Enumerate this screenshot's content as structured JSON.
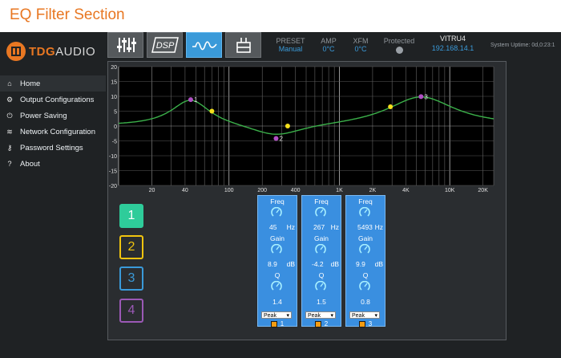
{
  "page_title": "EQ Filter Section",
  "brand": {
    "logo_prefix": "TDG",
    "logo_suffix": "AUDIO"
  },
  "nav": [
    {
      "icon": "home-icon",
      "glyph": "⌂",
      "label": "Home"
    },
    {
      "icon": "gear-icon",
      "glyph": "⚙",
      "label": "Output Configurations"
    },
    {
      "icon": "power-icon",
      "glyph": "⏻",
      "label": "Power Saving"
    },
    {
      "icon": "wifi-icon",
      "glyph": "≋",
      "label": "Network Configuration"
    },
    {
      "icon": "key-icon",
      "glyph": "⚷",
      "label": "Password Settings"
    },
    {
      "icon": "question-icon",
      "glyph": "?",
      "label": "About"
    }
  ],
  "toolbar": {
    "dsp_label": "DSP"
  },
  "status": {
    "preset_label": "PRESET",
    "preset_value": "Manual",
    "amp_label": "AMP",
    "amp_value": "0°C",
    "xfm_label": "XFM",
    "xfm_value": "0°C",
    "protected_label": "Protected",
    "device_name": "VITRU4",
    "device_ip": "192.168.14.1",
    "uptime": "System Uptime: 0d,0:23:1"
  },
  "graph": {
    "y_ticks": [
      "20",
      "15",
      "10",
      "5",
      "0",
      "-5",
      "-10",
      "-15",
      "-20"
    ],
    "x_ticks": [
      "20",
      "40",
      "100",
      "200",
      "400",
      "1K",
      "2K",
      "4K",
      "10K",
      "20K"
    ],
    "points": [
      {
        "label": "1",
        "freq": 45,
        "gain": 8.9
      },
      {
        "label": "2",
        "freq": 267,
        "gain": -4.2
      },
      {
        "label": "3",
        "freq": 5493,
        "gain": 9.9
      }
    ]
  },
  "bands": [
    {
      "label": "1",
      "color": "#2ecc9a",
      "active": true
    },
    {
      "label": "2",
      "color": "#f1c40f",
      "active": false
    },
    {
      "label": "3",
      "color": "#3a9ad9",
      "active": false
    },
    {
      "label": "4",
      "color": "#9b59b6",
      "active": false
    }
  ],
  "cards": [
    {
      "freq_label": "Freq",
      "freq": "45",
      "freq_unit": "Hz",
      "gain_label": "Gain",
      "gain": "8.9",
      "gain_unit": "dB",
      "q_label": "Q",
      "q": "1.4",
      "type": "Peak",
      "num": "1"
    },
    {
      "freq_label": "Freq",
      "freq": "267",
      "freq_unit": "Hz",
      "gain_label": "Gain",
      "gain": "-4.2",
      "gain_unit": "dB",
      "q_label": "Q",
      "q": "1.5",
      "type": "Peak",
      "num": "2"
    },
    {
      "freq_label": "Freq",
      "freq": "5493",
      "freq_unit": "Hz",
      "gain_label": "Gain",
      "gain": "9.9",
      "gain_unit": "dB",
      "q_label": "Q",
      "q": "0.8",
      "type": "Peak",
      "num": "3"
    }
  ],
  "colors": {
    "accent": "#3a9ad9",
    "brand": "#e87722",
    "curve": "#3bb04a",
    "point": "#b04fc4",
    "handle": "#f4e01c"
  }
}
